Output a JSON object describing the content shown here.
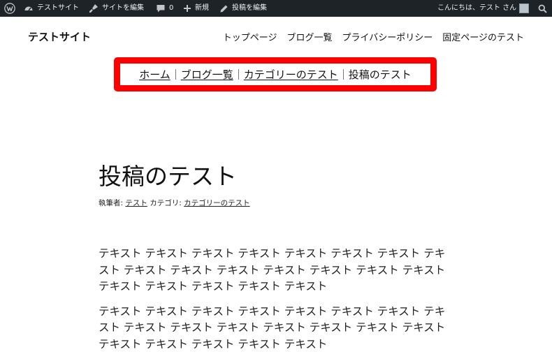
{
  "adminbar": {
    "site_name": "テストサイト",
    "customize": "サイトを編集",
    "comments_count": "0",
    "new": "新規",
    "edit_post": "投稿を編集",
    "greeting": "こんにちは、テスト さん"
  },
  "site": {
    "title": "テストサイト",
    "nav": [
      "トップページ",
      "ブログ一覧",
      "プライバシーポリシー",
      "固定ページのテスト"
    ]
  },
  "breadcrumb": {
    "items": [
      "ホーム",
      "ブログ一覧",
      "カテゴリーのテスト",
      "投稿のテスト"
    ],
    "highlight_color": "#ff0000"
  },
  "post": {
    "title": "投稿のテスト",
    "meta": {
      "author_label": "執筆者:",
      "author": "テスト",
      "category_label": "カテゴリ:",
      "category": "カテゴリーのテスト"
    },
    "paragraphs": [
      "テキスト テキスト テキスト テキスト テキスト テキスト テキスト テキスト テキスト テキスト テキスト テキスト テキスト テキスト テキスト テキスト テキスト テキスト テキスト テキスト",
      "テキスト テキスト テキスト テキスト テキスト テキスト テキスト テキスト テキスト テキスト テキスト テキスト テキスト テキスト テキスト テキスト テキスト テキスト テキスト テキスト"
    ]
  }
}
